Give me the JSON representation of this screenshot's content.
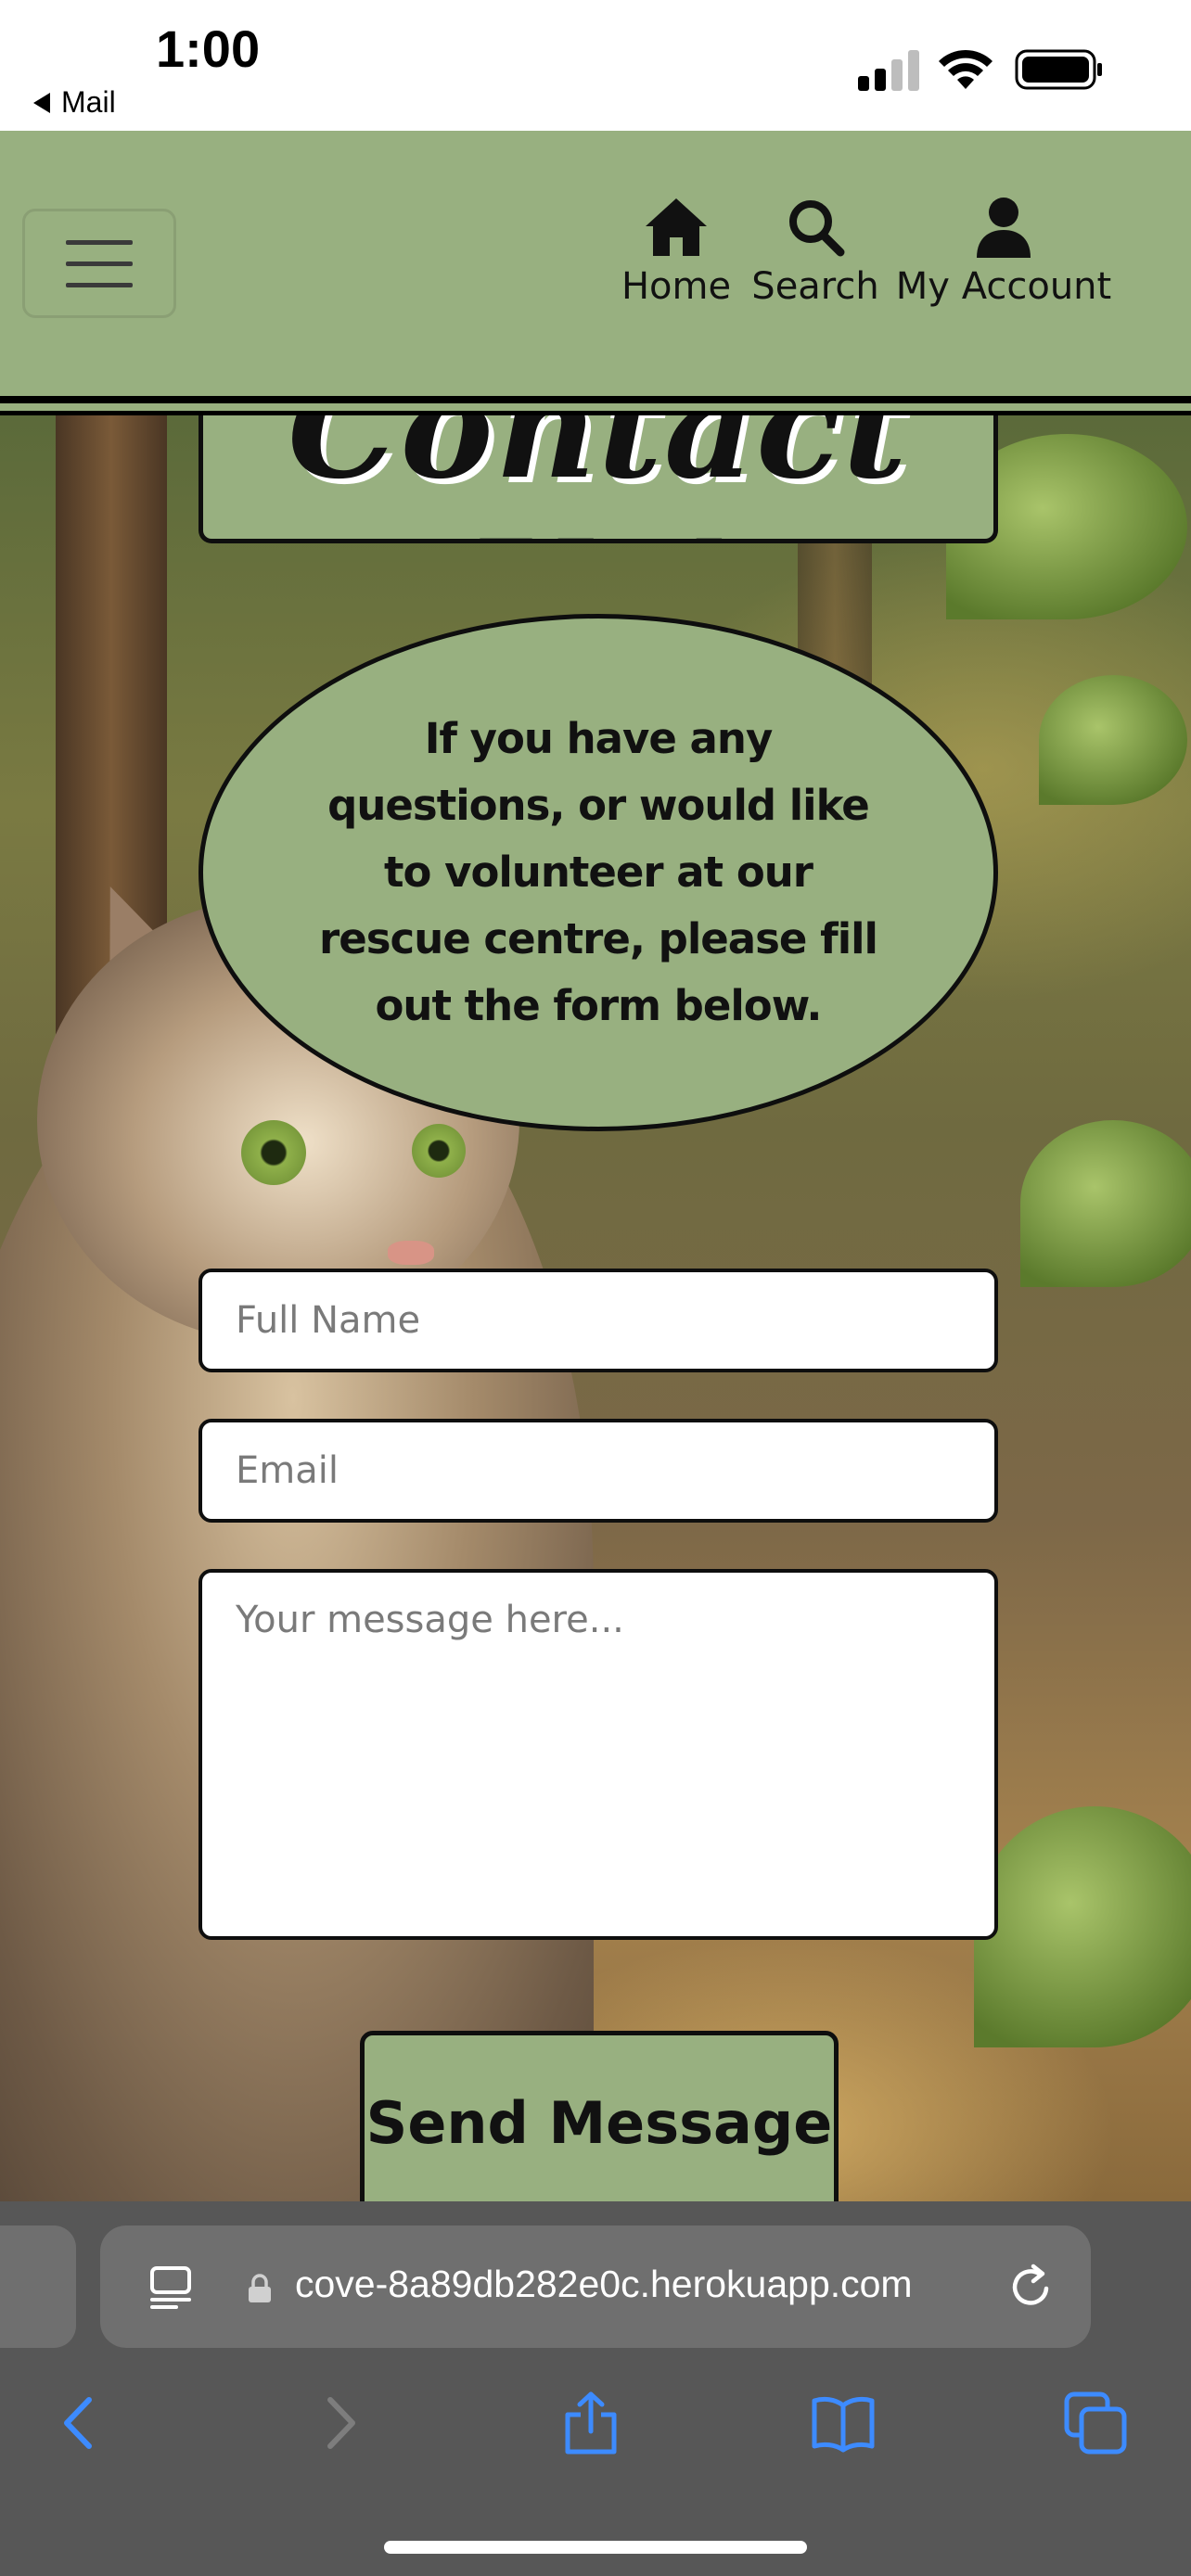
{
  "status_bar": {
    "time": "1:00",
    "back_app": "Mail",
    "icons": [
      "signal-icon",
      "wifi-icon",
      "battery-icon"
    ]
  },
  "navbar": {
    "menu_icon": "hamburger-icon",
    "items": [
      {
        "label": "Home",
        "icon": "home-icon"
      },
      {
        "label": "Search",
        "icon": "search-icon"
      },
      {
        "label": "My Account",
        "icon": "user-icon"
      }
    ]
  },
  "page": {
    "title": "Contact Us!",
    "intro": "If you have any questions, or would like to volunteer at our rescue centre, please fill out the form below."
  },
  "form": {
    "full_name_placeholder": "Full Name",
    "email_placeholder": "Email",
    "message_placeholder": "Your message here...",
    "submit_label": "Send Message"
  },
  "browser": {
    "url": "cove-8a89db282e0c.herokuapp.com",
    "toolbar": [
      "back-icon",
      "forward-icon",
      "share-icon",
      "bookmarks-icon",
      "tabs-icon"
    ]
  },
  "colors": {
    "accent_green": "#98b080",
    "border": "#0e0e0e",
    "safari_chrome": "#575757",
    "link_blue": "#3d8bff"
  }
}
